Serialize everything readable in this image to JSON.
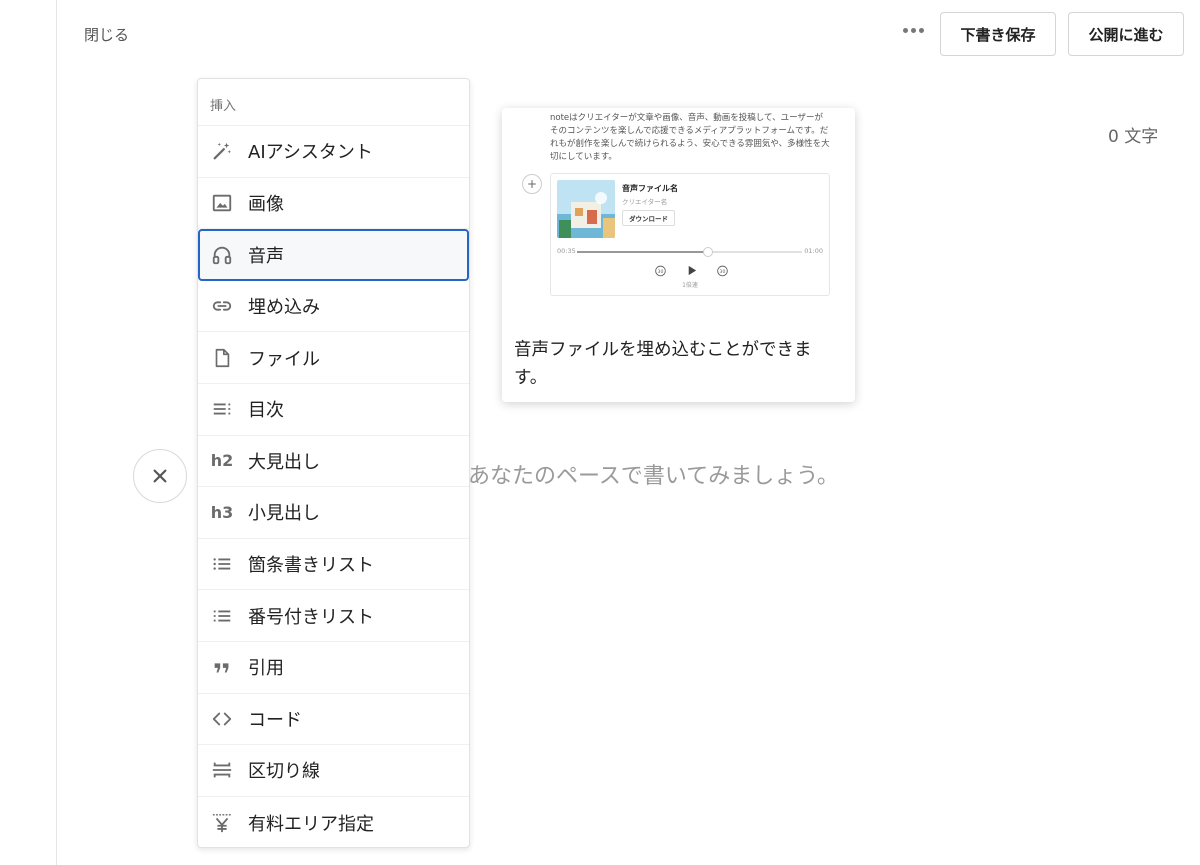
{
  "header": {
    "close_label": "閉じる",
    "draft_label": "下書き保存",
    "publish_label": "公開に進む"
  },
  "editor": {
    "char_count": "0 文字",
    "placeholder": "あなたのペースで書いてみましょう。"
  },
  "insert_menu": {
    "title": "挿入",
    "items": [
      {
        "label": "AIアシスタント",
        "icon": "magic-wand-icon"
      },
      {
        "label": "画像",
        "icon": "image-icon"
      },
      {
        "label": "音声",
        "icon": "headphones-icon",
        "active": true
      },
      {
        "label": "埋め込み",
        "icon": "link-icon"
      },
      {
        "label": "ファイル",
        "icon": "file-icon"
      },
      {
        "label": "目次",
        "icon": "toc-icon"
      },
      {
        "label": "大見出し",
        "icon": "h2",
        "icon_text": "h2"
      },
      {
        "label": "小見出し",
        "icon": "h3",
        "icon_text": "h3"
      },
      {
        "label": "箇条書きリスト",
        "icon": "bullet-list-icon"
      },
      {
        "label": "番号付きリスト",
        "icon": "numbered-list-icon"
      },
      {
        "label": "引用",
        "icon": "quote-icon"
      },
      {
        "label": "コード",
        "icon": "code-icon"
      },
      {
        "label": "区切り線",
        "icon": "divider-icon"
      },
      {
        "label": "有料エリア指定",
        "icon": "yen-icon"
      }
    ]
  },
  "preview": {
    "body_text": "noteはクリエイターが文章や画像、音声、動画を投稿して、ユーザーがそのコンテンツを楽しんで応援できるメディアプラットフォームです。だれもが創作を楽しんで続けられるよう、安心できる雰囲気や、多様性を大切にしています。",
    "player": {
      "title": "音声ファイル名",
      "creator": "クリエイター名",
      "download_label": "ダウンロード",
      "time_current": "00:35",
      "time_total": "01:00",
      "progress": 0.58,
      "skip_back": "30",
      "skip_forward": "30",
      "speed": "1倍速"
    },
    "caption": "音声ファイルを埋め込むことができます。"
  },
  "colors": {
    "accent": "#2565c8",
    "border": "#d5d5d5",
    "muted_text": "#9a9a9a"
  }
}
